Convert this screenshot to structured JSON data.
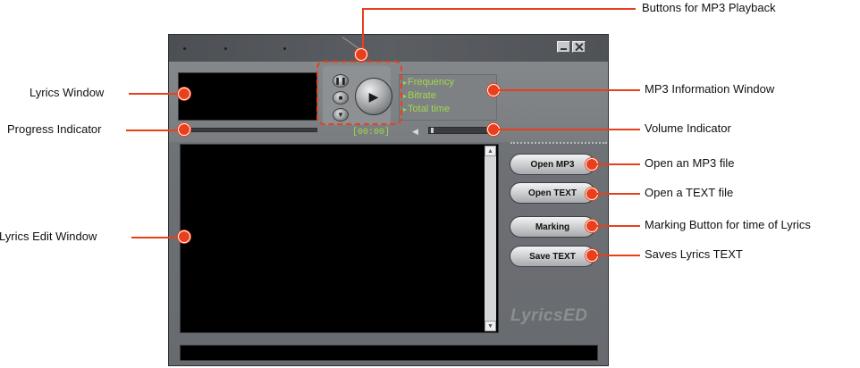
{
  "app": {
    "name": "LyricsED",
    "playback": {
      "pause_icon": "pause-icon",
      "stop_icon": "stop-icon",
      "eject_icon": "eject-icon",
      "play_icon": "play-icon"
    },
    "info": {
      "frequency": "Frequency",
      "bitrate": "Bitrate",
      "total_time": "Total time"
    },
    "time": "[00:00]",
    "buttons": {
      "open_mp3": "Open MP3",
      "open_text": "Open TEXT",
      "marking": "Marking",
      "save_text": "Save TEXT"
    }
  },
  "annotations": {
    "lyrics_window": "Lyrics Window",
    "progress_indicator": "Progress Indicator",
    "lyrics_edit_window": "Lyrics Edit Window",
    "mp3_playback": "Buttons for MP3 Playback",
    "mp3_info_window": "MP3 Information Window",
    "volume_indicator": "Volume Indicator",
    "open_mp3": "Open an MP3 file",
    "open_text": "Open a TEXT file",
    "marking": "Marking Button for time of Lyrics",
    "save_text": "Saves Lyrics TEXT"
  },
  "colors": {
    "accent": "#e8401c",
    "lcd_text": "#9fd84a",
    "screen": "#000000"
  }
}
